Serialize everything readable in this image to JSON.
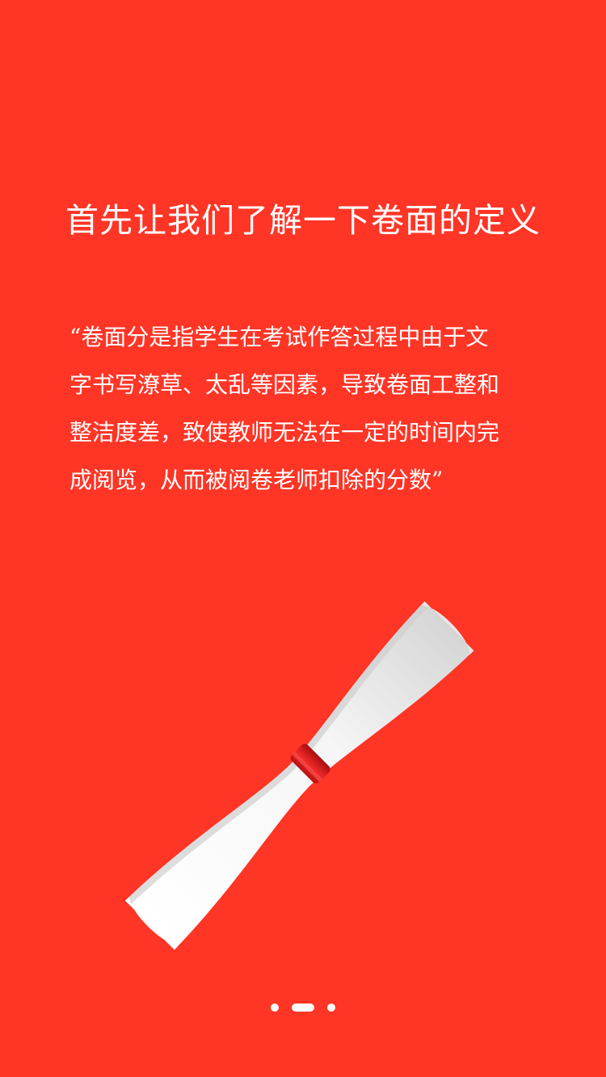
{
  "colors": {
    "background": "#ff3526",
    "text": "#ffffff",
    "ribbon": "#d9171a",
    "paper": "#f7f7f7",
    "paper_shadow": "#d4d4d4"
  },
  "title": "首先让我们了解一下卷面的定义",
  "quote_lines": [
    "“卷面分是指学生在考试作答过程中由于文",
    "字书写潦草、太乱等因素，导致卷面工整和",
    "整洁度差，致使教师无法在一定的时间内完",
    "成阅览，从而被阅卷老师扣除的分数”"
  ],
  "illustration": {
    "icon": "diploma-scroll-icon"
  },
  "pager": {
    "total_pages": 3,
    "current_page": 2
  }
}
